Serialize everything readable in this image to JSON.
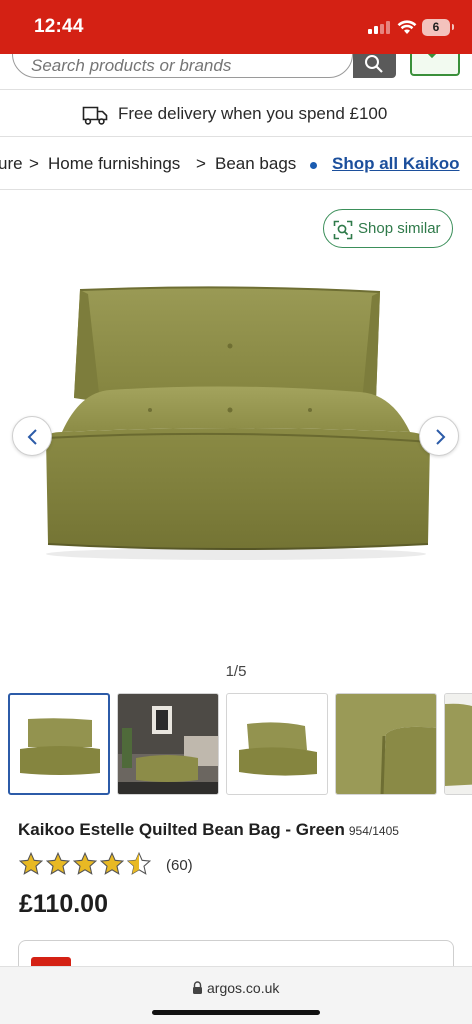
{
  "status_bar": {
    "time": "12:44",
    "battery": "6"
  },
  "search": {
    "placeholder": "Search products or brands"
  },
  "delivery": {
    "text": "Free delivery when you spend £100"
  },
  "breadcrumb": {
    "items": [
      "ure",
      "Home furnishings",
      "Bean bags"
    ],
    "shop_link": "Shop all Kaikoo"
  },
  "shop_similar": {
    "label": "Shop similar"
  },
  "gallery": {
    "counter": "1/5",
    "thumbnail_count": 5,
    "active_index": 0
  },
  "product": {
    "title": "Kaikoo Estelle Quilted Bean Bag - Green",
    "code": "954/1405",
    "rating": 4.5,
    "review_count": "(60)",
    "price": "£110.00"
  },
  "browser": {
    "url": "argos.co.uk"
  },
  "colors": {
    "brand_red": "#d42114",
    "link_blue": "#1c4f9c",
    "accent_green": "#3b8f5a",
    "star_gold": "#e8b923",
    "product_green": "#8a8a47"
  }
}
